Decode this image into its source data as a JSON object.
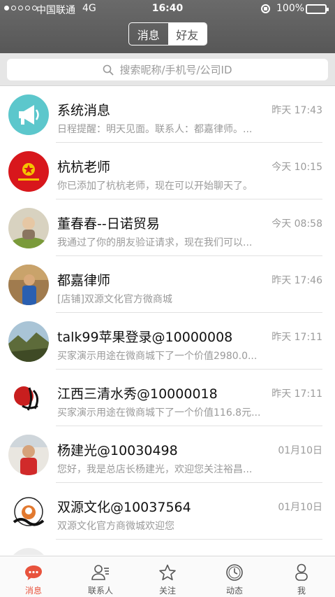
{
  "status": {
    "carrier": "中国联通",
    "network": "4G",
    "time": "16:40",
    "battery": "100%",
    "battery_color": "#4cd964"
  },
  "nav": {
    "segments": [
      {
        "label": "消息",
        "active": false
      },
      {
        "label": "好友",
        "active": true
      }
    ]
  },
  "search": {
    "placeholder": "搜索昵称/手机号/公司ID",
    "icon": "search-icon"
  },
  "conversations": [
    {
      "name": "系统消息",
      "time": "昨天 17:43",
      "preview": "日程提醒：明天见面。联系人：都嘉律师。...",
      "avatar": "megaphone-icon"
    },
    {
      "name": "杭杭老师",
      "time": "今天 10:15",
      "preview": "你已添加了杭杭老师，现在可以开始聊天了。",
      "avatar": "red-emblem"
    },
    {
      "name": "董春春--日诺贸易",
      "time": "今天 08:58",
      "preview": "我通过了你的朋友验证请求，现在我们可以...",
      "avatar": "person-photo"
    },
    {
      "name": "都嘉律师",
      "time": "昨天 17:46",
      "preview": "[店铺]双源文化官方微商城",
      "avatar": "person-photo"
    },
    {
      "name": "talk99苹果登录@10000008",
      "time": "昨天 17:11",
      "preview": "买家演示用途在微商城下了一个价值2980.0...",
      "avatar": "landscape-photo"
    },
    {
      "name": "江西三清水秀@10000018",
      "time": "昨天 17:11",
      "preview": "买家演示用途在微商城下了一个价值116.8元...",
      "avatar": "calligraphy-logo"
    },
    {
      "name": "杨建光@10030498",
      "time": "01月10日",
      "preview": "您好，我是总店长杨建光，欢迎您关注裕昌...",
      "avatar": "person-photo"
    },
    {
      "name": "双源文化@10037564",
      "time": "01月10日",
      "preview": "双源文化官方商微城欢迎您",
      "avatar": "culture-logo"
    },
    {
      "name": "",
      "time": "",
      "preview": "",
      "avatar": "partial"
    }
  ],
  "tabbar": {
    "tabs": [
      {
        "label": "消息",
        "icon": "chat-bubble-icon",
        "active": true
      },
      {
        "label": "联系人",
        "icon": "contacts-icon",
        "active": false
      },
      {
        "label": "关注",
        "icon": "star-icon",
        "active": false
      },
      {
        "label": "动态",
        "icon": "clock-icon",
        "active": false
      },
      {
        "label": "我",
        "icon": "person-icon",
        "active": false
      }
    ],
    "active_color": "#e8533d"
  }
}
